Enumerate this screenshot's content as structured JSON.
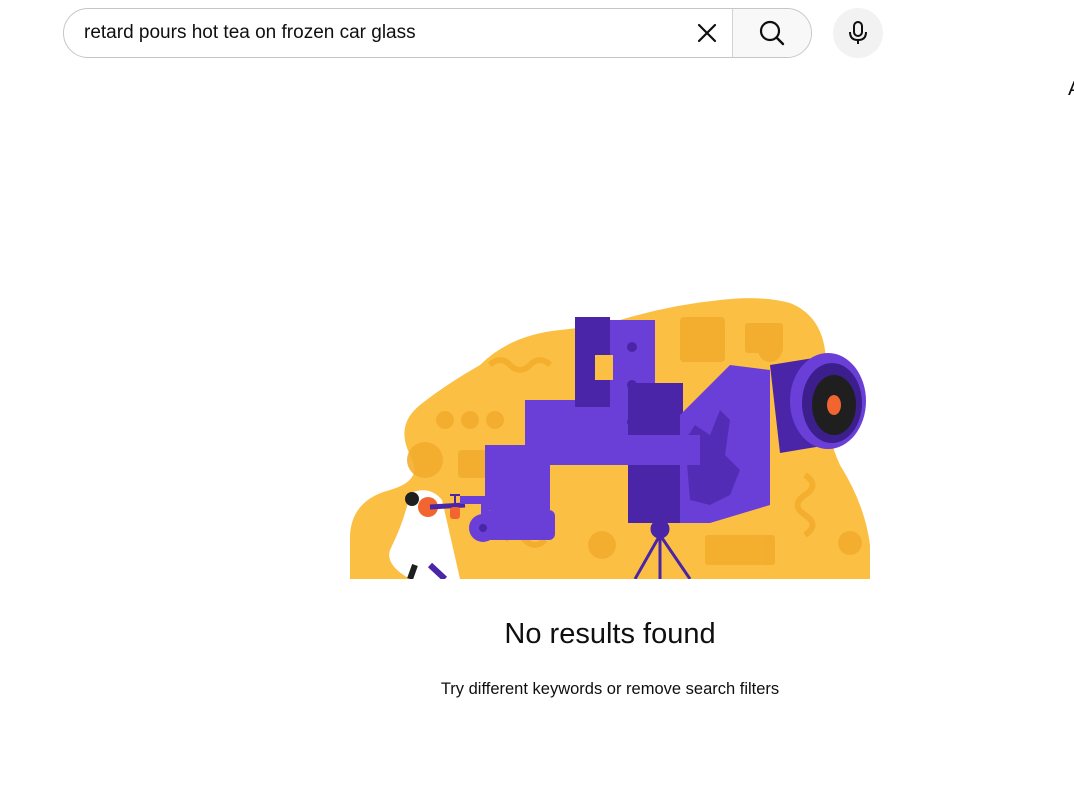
{
  "search": {
    "query": "retard pours hot tea on frozen car glass",
    "clear_icon": "close-icon",
    "search_icon": "search-icon",
    "mic_icon": "microphone-icon"
  },
  "edge_text": "A",
  "empty_state": {
    "illustration": "telescope-illustration",
    "title": "No results found",
    "hint": "Try different keywords or remove search filters"
  },
  "colors": {
    "illustration_yellow": "#fbc043",
    "illustration_purple": "#6a3fd8",
    "illustration_dark_purple": "#4a25a8",
    "illustration_orange": "#f26531"
  }
}
